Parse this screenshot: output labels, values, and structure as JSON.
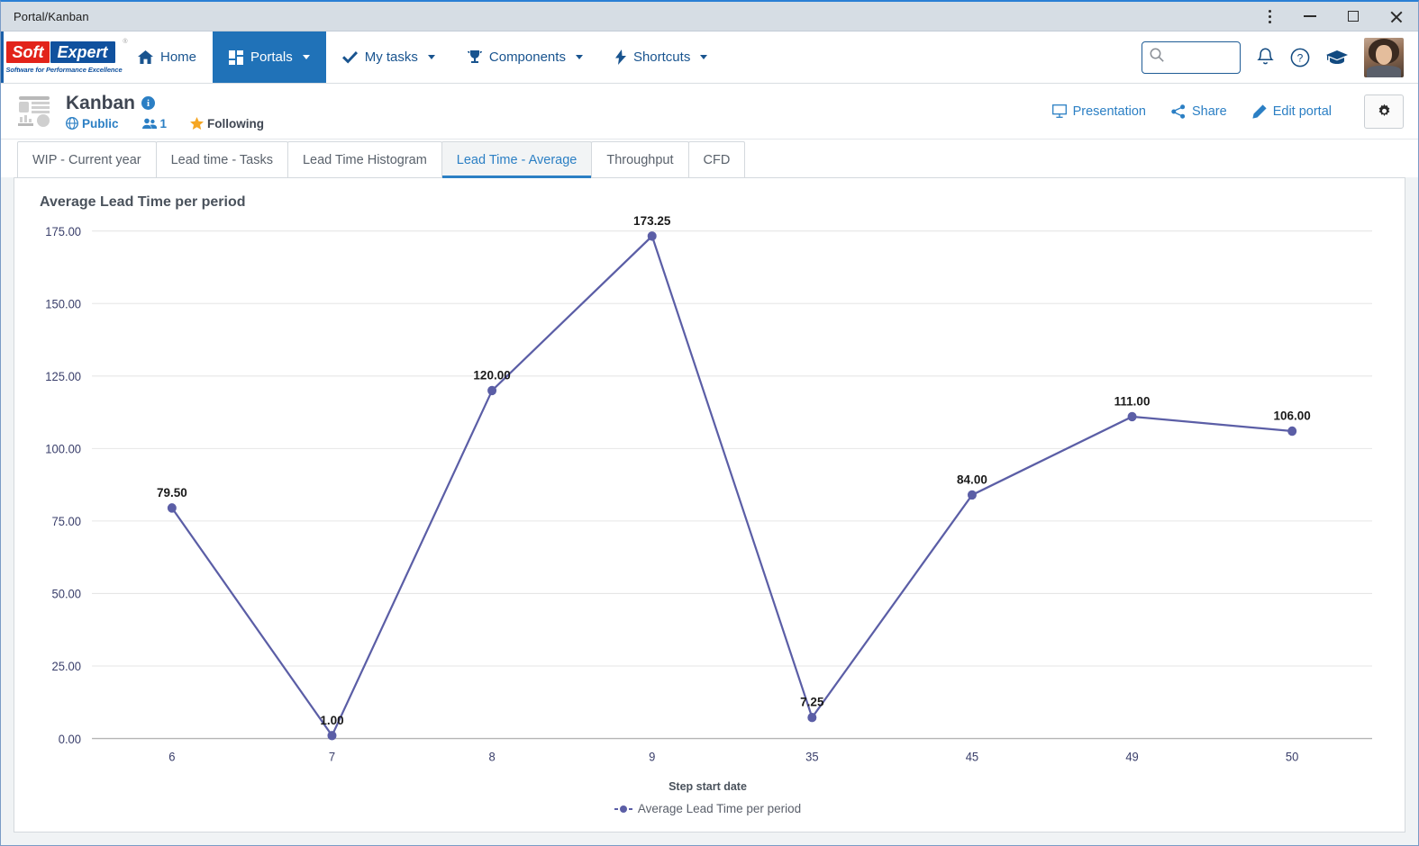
{
  "window": {
    "title": "Portal/Kanban",
    "controls": {
      "menu": "kebab-menu",
      "minimize": "Minimize",
      "maximize": "Maximize",
      "close": "Close"
    }
  },
  "navbar": {
    "logo": {
      "part1": "Soft",
      "part2": "Expert",
      "registered": "®",
      "tagline": "Software for Performance Excellence"
    },
    "items": [
      {
        "label": "Home",
        "icon": "home-icon",
        "has_caret": false,
        "active": false
      },
      {
        "label": "Portals",
        "icon": "grid-icon",
        "has_caret": true,
        "active": true
      },
      {
        "label": "My tasks",
        "icon": "check-icon",
        "has_caret": true,
        "active": false
      },
      {
        "label": "Components",
        "icon": "trophy-icon",
        "has_caret": true,
        "active": false
      },
      {
        "label": "Shortcuts",
        "icon": "bolt-icon",
        "has_caret": true,
        "active": false
      }
    ],
    "search": {
      "value": "",
      "placeholder": ""
    },
    "right_icons": [
      "bell-icon",
      "help-icon",
      "graduation-cap-icon",
      "avatar"
    ]
  },
  "portal_header": {
    "title": "Kanban",
    "info_badge": "i",
    "visibility": "Public",
    "members_count": "1",
    "following": "Following",
    "actions": [
      {
        "label": "Presentation",
        "icon": "presentation-icon"
      },
      {
        "label": "Share",
        "icon": "share-icon"
      },
      {
        "label": "Edit portal",
        "icon": "pencil-icon"
      }
    ],
    "settings_icon": "gear-icon"
  },
  "tabs": [
    {
      "label": "WIP - Current year",
      "active": false
    },
    {
      "label": "Lead time - Tasks",
      "active": false
    },
    {
      "label": "Lead Time Histogram",
      "active": false
    },
    {
      "label": "Lead Time - Average",
      "active": true
    },
    {
      "label": "Throughput",
      "active": false
    },
    {
      "label": "CFD",
      "active": false
    }
  ],
  "card": {
    "title": "Average Lead Time per period"
  },
  "colors": {
    "accent": "#2b7fc4",
    "nav_active_bg": "#2072b8",
    "series": "#5b5ea6",
    "logo_red": "#e2231a",
    "logo_blue": "#10519e",
    "star": "#f5a623",
    "grid": "#e6e6e6"
  },
  "chart_data": {
    "type": "line",
    "title": "Average Lead Time per period",
    "xlabel": "Step start date",
    "ylabel": "",
    "categories": [
      "6",
      "7",
      "8",
      "9",
      "35",
      "45",
      "49",
      "50"
    ],
    "values": [
      79.5,
      1.0,
      120.0,
      173.25,
      7.25,
      84.0,
      111.0,
      106.0
    ],
    "point_labels": [
      "79.50",
      "1.00",
      "120.00",
      "173.25",
      "7.25",
      "84.00",
      "111.00",
      "106.00"
    ],
    "ylim": [
      0,
      175
    ],
    "ytick_values": [
      0,
      25,
      50,
      75,
      100,
      125,
      150,
      175
    ],
    "ytick_labels": [
      "0.00",
      "25.00",
      "50.00",
      "75.00",
      "100.00",
      "125.00",
      "150.00",
      "175.00"
    ],
    "grid": true,
    "legend": [
      {
        "name": "Average Lead Time per period",
        "color": "#5b5ea6"
      }
    ],
    "legend_position": "bottom",
    "series": [
      {
        "name": "Average Lead Time per period",
        "color": "#5b5ea6",
        "values": [
          79.5,
          1.0,
          120.0,
          173.25,
          7.25,
          84.0,
          111.0,
          106.0
        ]
      }
    ]
  }
}
